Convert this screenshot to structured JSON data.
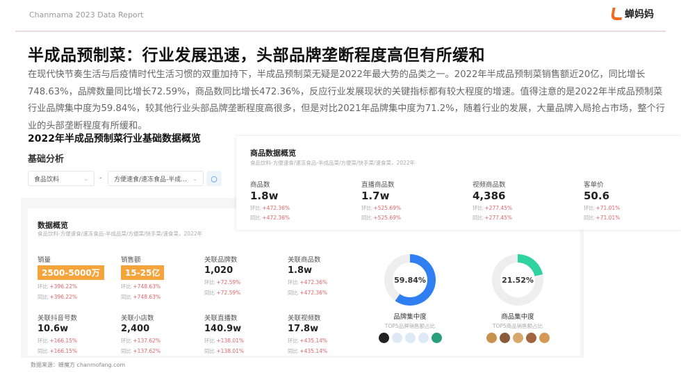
{
  "header": {
    "report_label": "Chanmama 2023 Data Report",
    "logo_text": "蝉妈妈"
  },
  "title": "半成品预制菜：行业发展迅速，头部品牌垄断程度高但有所缓和",
  "paragraph": "在现代快节奏生活与后疫情时代生活习惯的双重加持下，半成品预制菜无疑是2022年最大势的品类之一。2022年半成品预制菜销售额近20亿，同比增长748.63%，品牌数量同比增长72.59%，商品数同比增长472.36%，反应行业发展现状的关键指标都有较大程度的增速。值得注意的是2022年半成品预制菜行业品牌集中度为59.84%，较其他行业头部品牌垄断程度高很多，但是对比2021年品牌集中度为71.2%，随着行业的发展，大量品牌入局抢占市场，整个行业的头部垄断程度有所缓和。",
  "section_title": "2022年半成品预制菜行业基础数据概览",
  "basic": {
    "title": "基础分析",
    "select1": "食品饮料",
    "dash": "-",
    "select2": "方便速食/速冻食品-半成...",
    "chev": "⌄",
    "search_icon": "search-icon"
  },
  "overview": {
    "title": "数据概览",
    "subtitle": "食品饮料-方便速食/速冻食品-半成品菜/方便菜/快手菜/速食菜，2022年",
    "metrics": [
      {
        "label": "销量",
        "value": "2500-5000万",
        "hb": "+396.22%",
        "tb": "+396.22%",
        "highlight": true
      },
      {
        "label": "销售额",
        "value": "15-25亿",
        "hb": "+748.63%",
        "tb": "+748.63%",
        "highlight": true
      },
      {
        "label": "关联品牌数",
        "value": "1,020",
        "hb": "+72.59%",
        "tb": "+72.59%"
      },
      {
        "label": "关联商品数",
        "value": "1.8w",
        "hb": "+472.36%",
        "tb": "+472.36%"
      },
      {
        "label": "关联抖音号数",
        "value": "10.6w",
        "hb": "+166.15%",
        "tb": "+166.15%"
      },
      {
        "label": "关联小店数",
        "value": "2,400",
        "hb": "+137.62%",
        "tb": "+137.62%"
      },
      {
        "label": "关联直播数",
        "value": "140.9w",
        "hb": "+138.01%",
        "tb": "+138.01%"
      },
      {
        "label": "关联视频数",
        "value": "17.8w",
        "hb": "+435.14%",
        "tb": "+435.14%"
      }
    ],
    "hb_label": "环比",
    "tb_label": "同比",
    "donuts": [
      {
        "value": "59.84%",
        "fraction": 0.5984,
        "color": "#2f7ff0",
        "title": "品牌集中度",
        "subtitle": "TOP5品牌销售额占比"
      },
      {
        "value": "21.52%",
        "fraction": 0.2152,
        "color": "#2fd3a0",
        "title": "商品集中度",
        "subtitle": "TOP5商品销售额占比"
      }
    ]
  },
  "product": {
    "title": "商品数据概览",
    "subtitle": "食品饮料-方便速食/速冻食品-半成品菜/方便菜/快手菜/速食菜，2022年",
    "metrics": [
      {
        "label": "商品数",
        "value": "1.8w",
        "hb": "+472.36%",
        "tb": "+472.36%"
      },
      {
        "label": "直播商品数",
        "value": "1.7w",
        "hb": "+525.69%",
        "tb": "+525.69%"
      },
      {
        "label": "视频商品数",
        "value": "4,386",
        "hb": "+277.45%",
        "tb": "+277.45%"
      },
      {
        "label": "客单价",
        "value": "50.6",
        "hb": "+71.01%",
        "tb": "+71.01%"
      }
    ]
  },
  "source": "数据来源：蝉魔方 chanmofang.com"
}
